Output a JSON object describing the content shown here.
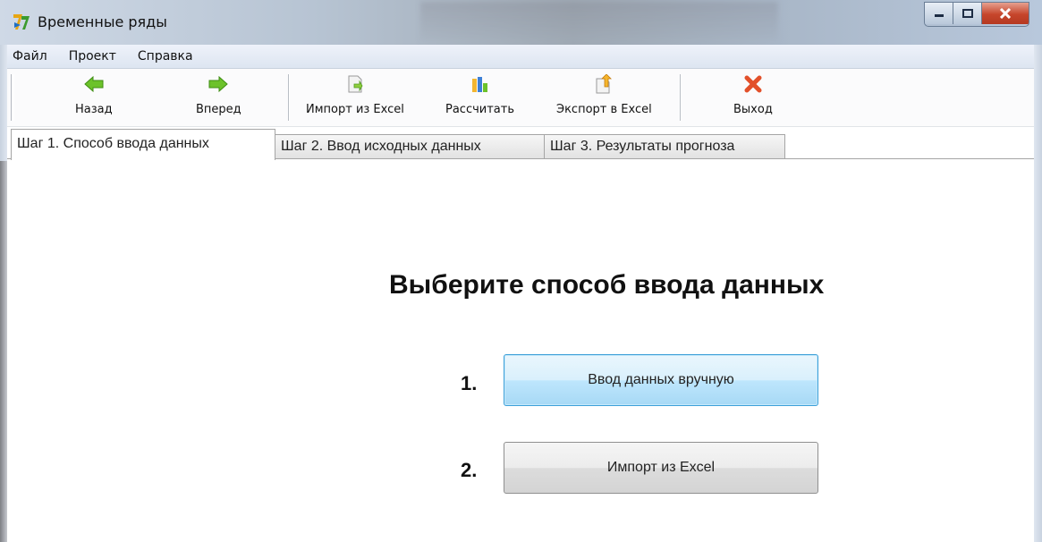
{
  "window": {
    "title": "Временные ряды",
    "icon": "app-logo-icon"
  },
  "menu": {
    "items": [
      {
        "label": "Файл"
      },
      {
        "label": "Проект"
      },
      {
        "label": "Справка"
      }
    ]
  },
  "toolbar": {
    "buttons": [
      {
        "label": "Назад",
        "icon": "arrow-left-icon"
      },
      {
        "label": "Вперед",
        "icon": "arrow-right-icon"
      },
      {
        "label": "Импорт из Excel",
        "icon": "import-document-icon"
      },
      {
        "label": "Рассчитать",
        "icon": "bar-chart-icon"
      },
      {
        "label": "Экспорт в Excel",
        "icon": "export-document-icon"
      },
      {
        "label": "Выход",
        "icon": "close-x-icon"
      }
    ]
  },
  "tabs": [
    {
      "label": "Шаг 1. Способ ввода данных",
      "active": true
    },
    {
      "label": "Шаг 2. Ввод исходных данных",
      "active": false
    },
    {
      "label": "Шаг 3. Результаты прогноза",
      "active": false
    }
  ],
  "main": {
    "heading": "Выберите способ ввода данных",
    "options": [
      {
        "number": "1.",
        "label": "Ввод данных вручную"
      },
      {
        "number": "2.",
        "label": "Импорт из Excel"
      }
    ]
  },
  "colors": {
    "focus_border": "#3c9fd8",
    "close_button": "#c6452b",
    "arrow_green": "#6cc22a",
    "exit_red": "#e2502a"
  }
}
